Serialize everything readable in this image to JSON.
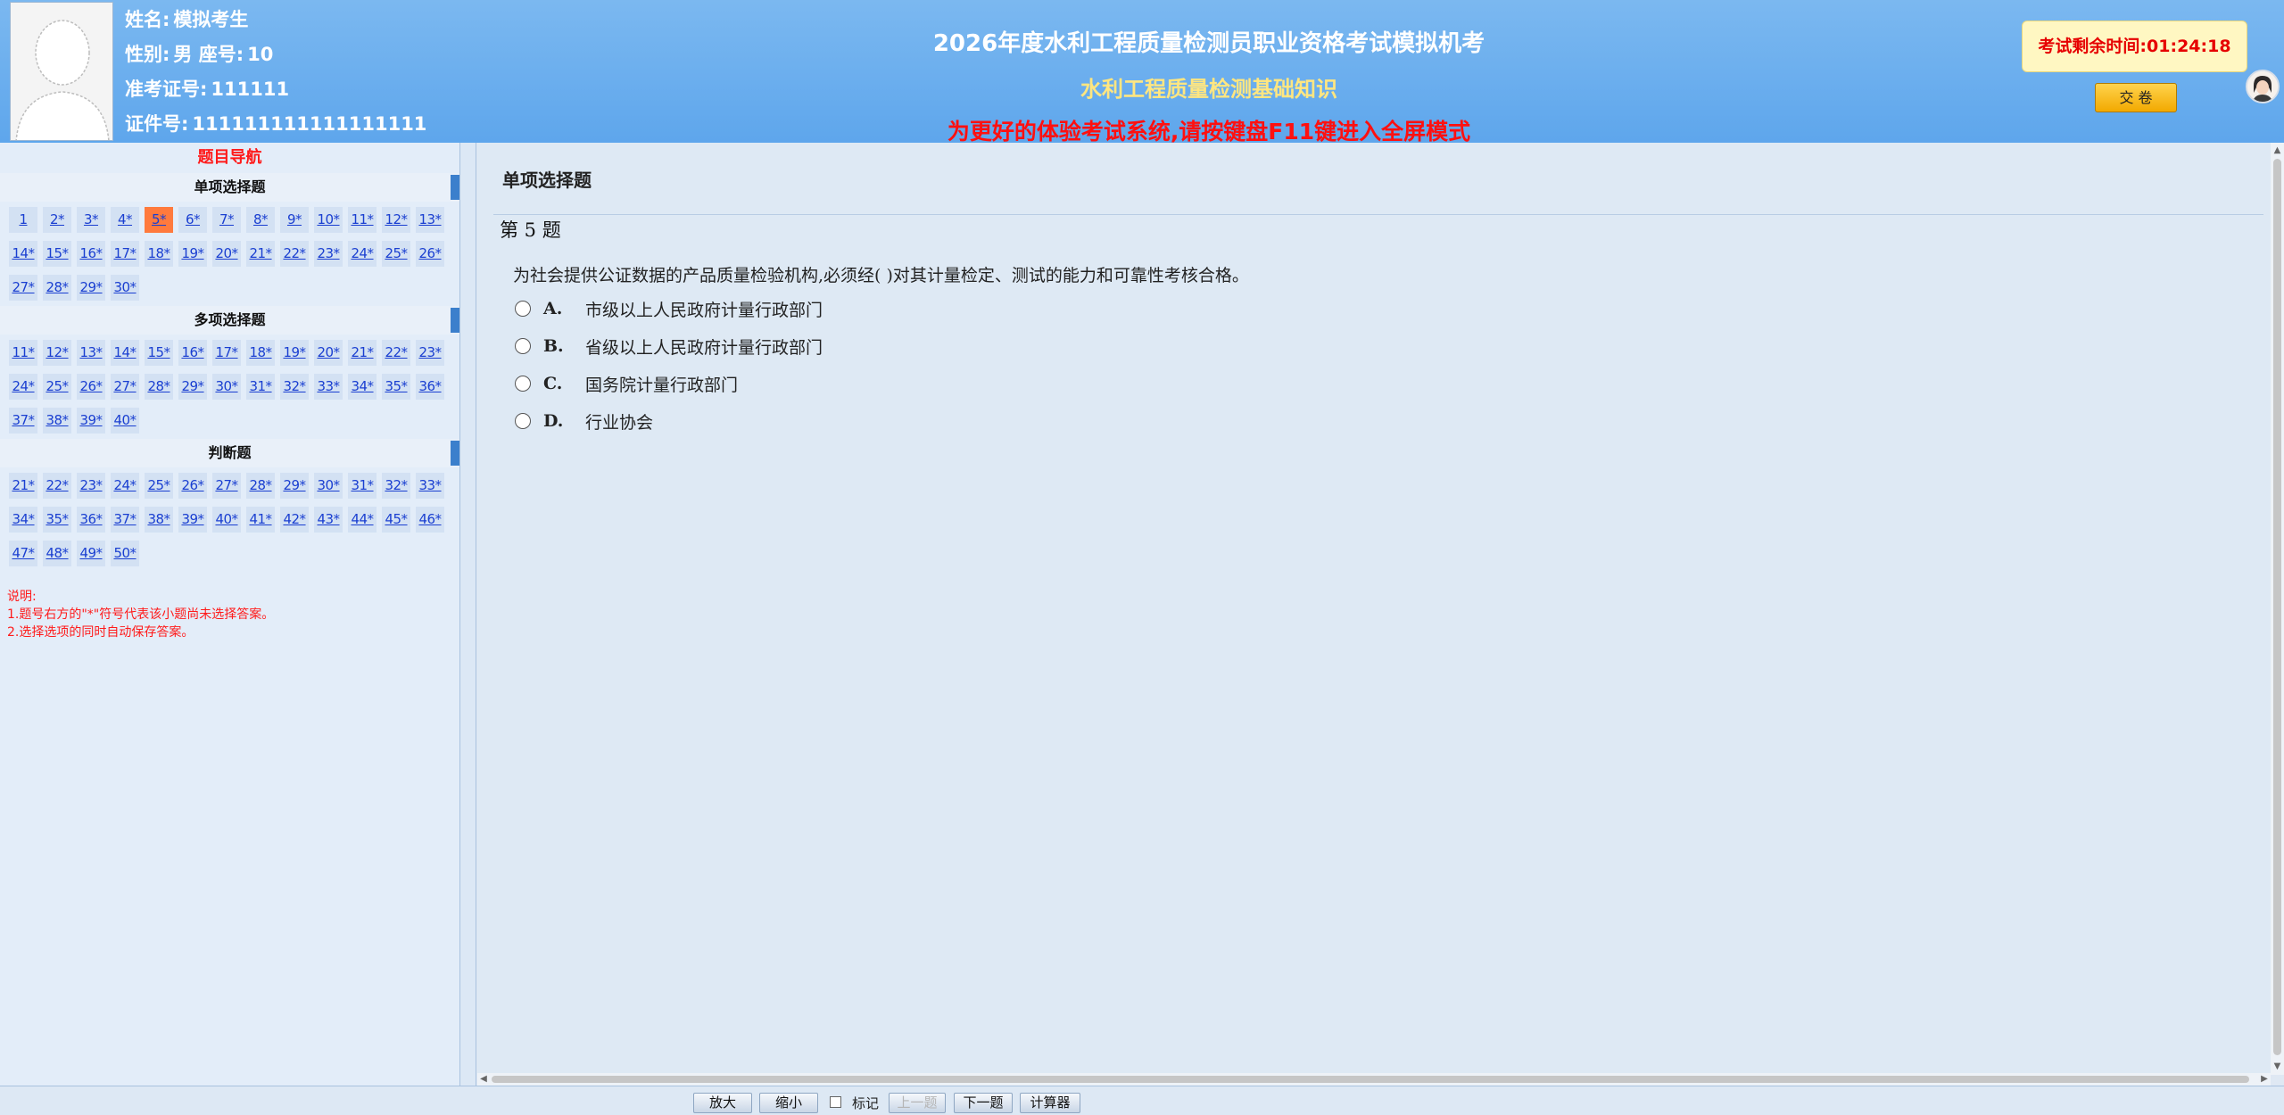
{
  "candidate": {
    "name_label": "姓名:",
    "name": "模拟考生",
    "gender_label": "性别:",
    "gender": "男",
    "seat_label": "座号:",
    "seat": "10",
    "admission_label": "准考证号:",
    "admission_no": "111111",
    "id_label": "证件号:",
    "id_no": "111111111111111111"
  },
  "header": {
    "exam_title": "2026年度水利工程质量检测员职业资格考试模拟机考",
    "subject_title": "水利工程质量检测基础知识",
    "fullscreen_tip": "为更好的体验考试系统,请按键盘F11键进入全屏模式",
    "timer_label": "考试剩余时间:",
    "timer_value": "01:24:18",
    "submit_label": "交 卷"
  },
  "nav": {
    "title": "题目导航",
    "sections": [
      {
        "title": "单项选择题",
        "items": [
          "1",
          "2*",
          "3*",
          "4*",
          "5*",
          "6*",
          "7*",
          "8*",
          "9*",
          "10*",
          "11*",
          "12*",
          "13*",
          "14*",
          "15*",
          "16*",
          "17*",
          "18*",
          "19*",
          "20*",
          "21*",
          "22*",
          "23*",
          "24*",
          "25*",
          "26*",
          "27*",
          "28*",
          "29*",
          "30*"
        ],
        "current_index": 4
      },
      {
        "title": "多项选择题",
        "items": [
          "11*",
          "12*",
          "13*",
          "14*",
          "15*",
          "16*",
          "17*",
          "18*",
          "19*",
          "20*",
          "21*",
          "22*",
          "23*",
          "24*",
          "25*",
          "26*",
          "27*",
          "28*",
          "29*",
          "30*",
          "31*",
          "32*",
          "33*",
          "34*",
          "35*",
          "36*",
          "37*",
          "38*",
          "39*",
          "40*"
        ],
        "current_index": -1
      },
      {
        "title": "判断题",
        "items": [
          "21*",
          "22*",
          "23*",
          "24*",
          "25*",
          "26*",
          "27*",
          "28*",
          "29*",
          "30*",
          "31*",
          "32*",
          "33*",
          "34*",
          "35*",
          "36*",
          "37*",
          "38*",
          "39*",
          "40*",
          "41*",
          "42*",
          "43*",
          "44*",
          "45*",
          "46*",
          "47*",
          "48*",
          "49*",
          "50*"
        ],
        "current_index": -1
      }
    ],
    "notes": [
      "说明:",
      "1.题号右方的\"*\"符号代表该小题尚未选择答案。",
      "2.选择选项的同时自动保存答案。"
    ]
  },
  "question": {
    "section_title": "单项选择题",
    "number_text": "第 5 题",
    "stem": "为社会提供公证数据的产品质量检验机构,必须经(  )对其计量检定、测试的能力和可靠性考核合格。",
    "options": [
      {
        "letter": "A.",
        "text": "市级以上人民政府计量行政部门"
      },
      {
        "letter": "B.",
        "text": "省级以上人民政府计量行政部门"
      },
      {
        "letter": "C.",
        "text": "国务院计量行政部门"
      },
      {
        "letter": "D.",
        "text": "行业协会"
      }
    ]
  },
  "toolbar": {
    "zoom_in": "放大",
    "zoom_out": "缩小",
    "mark": "标记",
    "prev": "上一题",
    "next": "下一题",
    "calculator": "计算器"
  },
  "colors": {
    "header_bg": "#5ea6ec",
    "current_question": "#ff7a3d",
    "alert_red": "#ff1a1a",
    "subject_yellow": "#ffe680"
  }
}
